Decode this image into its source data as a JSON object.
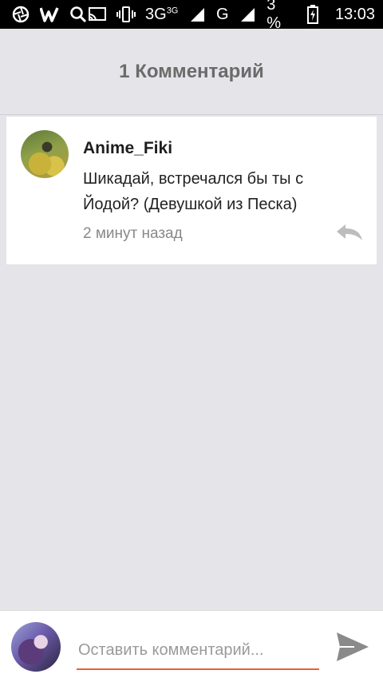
{
  "status_bar": {
    "network_1": "3G",
    "network_1_sup": "3G",
    "network_2": "G",
    "battery": "3 %",
    "time": "13:03"
  },
  "header": {
    "title": "1 Комментарий"
  },
  "comments": [
    {
      "author": "Anime_Fiki",
      "text": "Шикадай, встречался бы ты с Йодой? (Девушкой из Песка)",
      "time": "2 минут назад"
    }
  ],
  "input": {
    "placeholder": "Оставить комментарий...",
    "value": ""
  },
  "colors": {
    "accent": "#e8622a",
    "background": "#e5e4e8",
    "icon_gray": "#bdbdbd"
  }
}
